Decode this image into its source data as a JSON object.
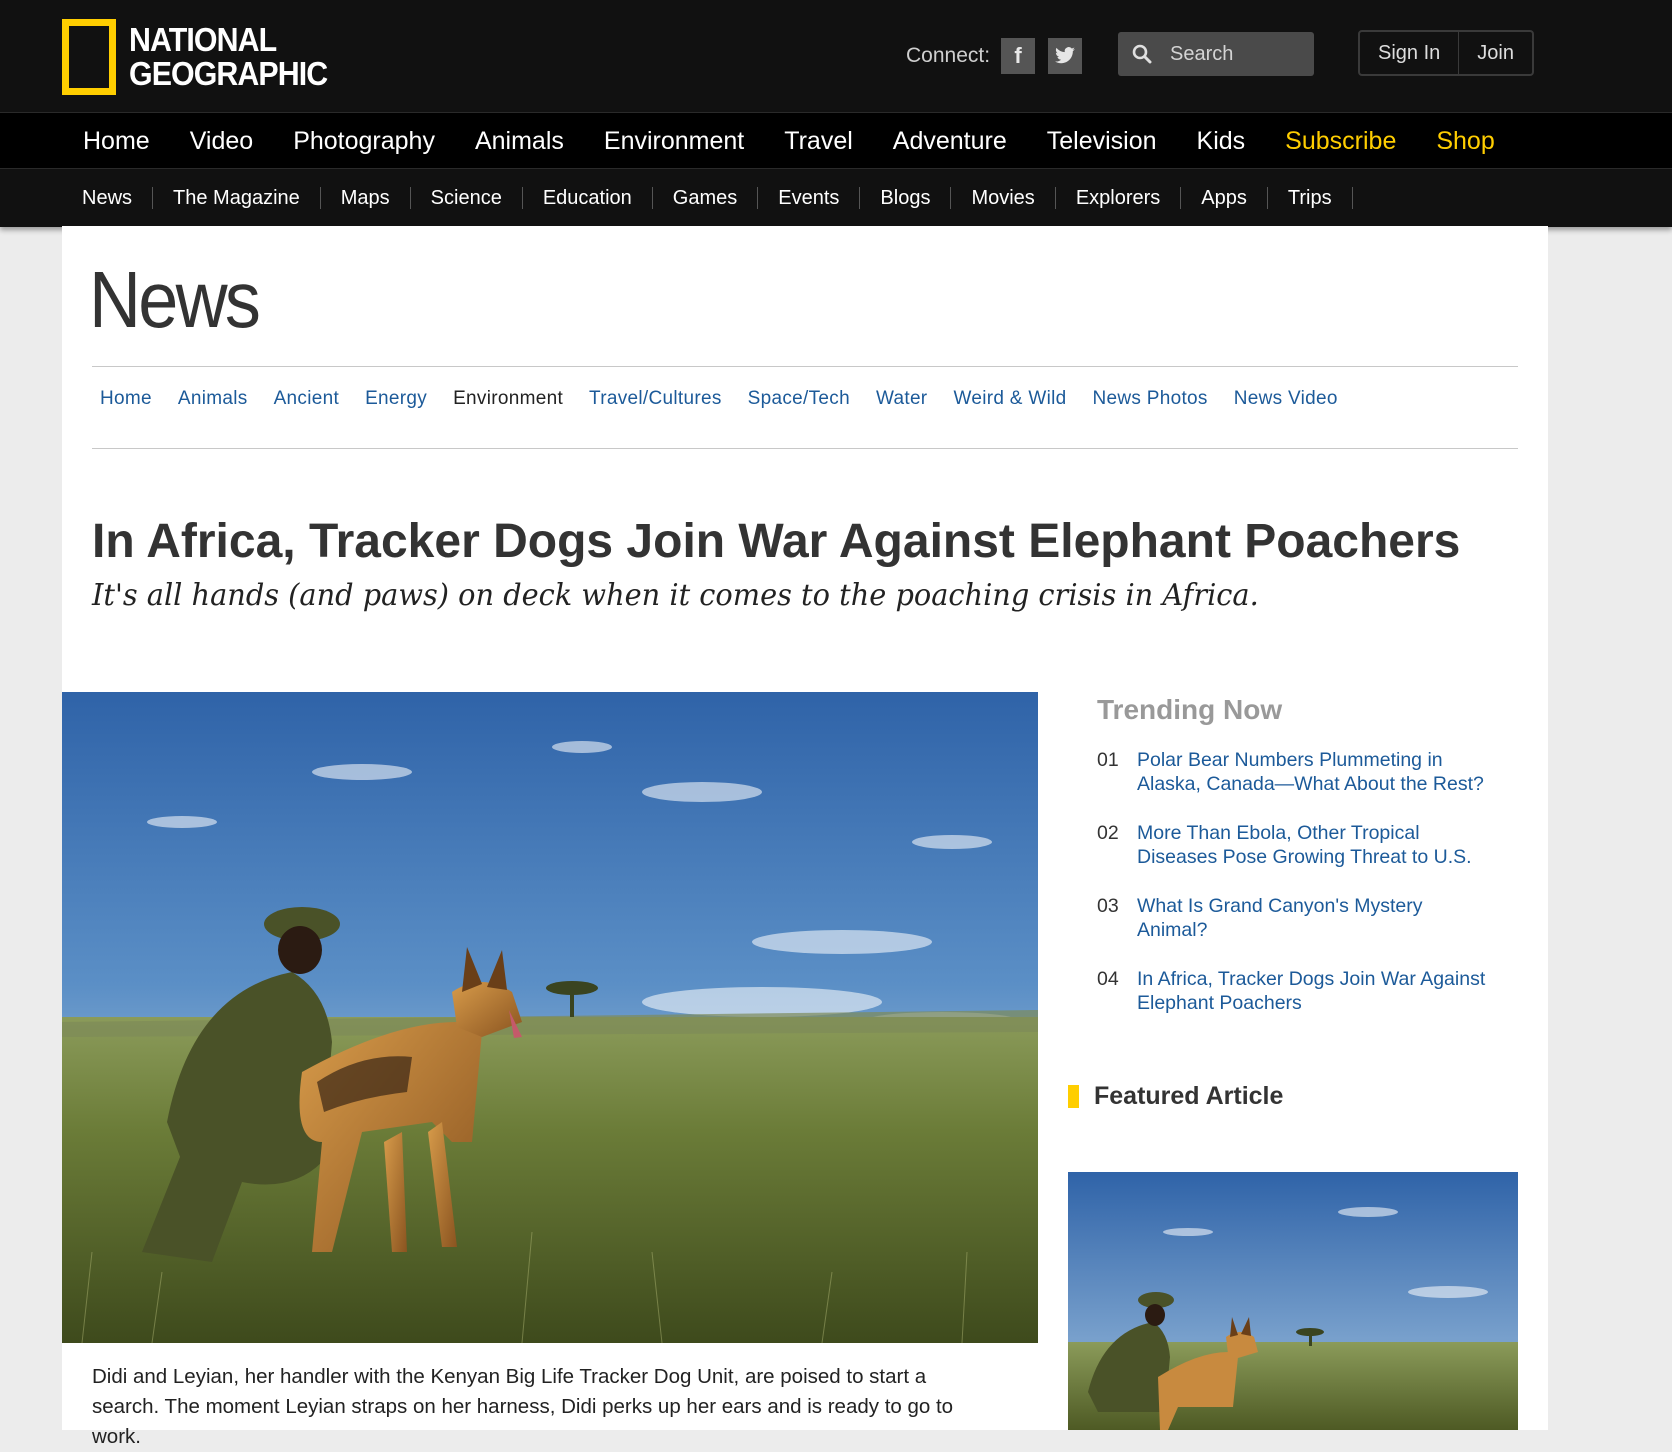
{
  "brand": {
    "logo_line1": "NATIONAL",
    "logo_line2": "GEOGRAPHIC",
    "yellow": "#ffce00"
  },
  "header": {
    "connect_label": "Connect:",
    "facebook_glyph": "f",
    "search_placeholder": "Search",
    "sign_in": "Sign In",
    "join": "Join"
  },
  "main_nav": [
    "Home",
    "Video",
    "Photography",
    "Animals",
    "Environment",
    "Travel",
    "Adventure",
    "Television",
    "Kids",
    "Subscribe",
    "Shop"
  ],
  "sub_nav": [
    "News",
    "The Magazine",
    "Maps",
    "Science",
    "Education",
    "Games",
    "Events",
    "Blogs",
    "Movies",
    "Explorers",
    "Apps",
    "Trips"
  ],
  "section": {
    "title": "News",
    "nav": [
      "Home",
      "Animals",
      "Ancient",
      "Energy",
      "Environment",
      "Travel/Cultures",
      "Space/Tech",
      "Water",
      "Weird & Wild",
      "News Photos",
      "News Video"
    ],
    "active": "Environment"
  },
  "article": {
    "headline": "In Africa, Tracker Dogs Join War Against Elephant Poachers",
    "dek": "It's all hands (and paws) on deck when it comes to the poaching crisis in Africa.",
    "caption": "Didi and Leyian, her handler with the Kenyan Big Life Tracker Dog Unit, are poised to start a search. The moment Leyian straps on her harness, Didi perks up her ears and is ready to go to work."
  },
  "sidebar": {
    "trending_title": "Trending Now",
    "trending": [
      {
        "num": "01",
        "title": "Polar Bear Numbers Plummeting in Alaska, Canada—What About the Rest?"
      },
      {
        "num": "02",
        "title": "More Than Ebola, Other Tropical Diseases Pose Growing Threat to U.S."
      },
      {
        "num": "03",
        "title": "What Is Grand Canyon's Mystery Animal?"
      },
      {
        "num": "04",
        "title": "In Africa, Tracker Dogs Join War Against Elephant Poachers"
      }
    ],
    "featured_title": "Featured Article"
  }
}
